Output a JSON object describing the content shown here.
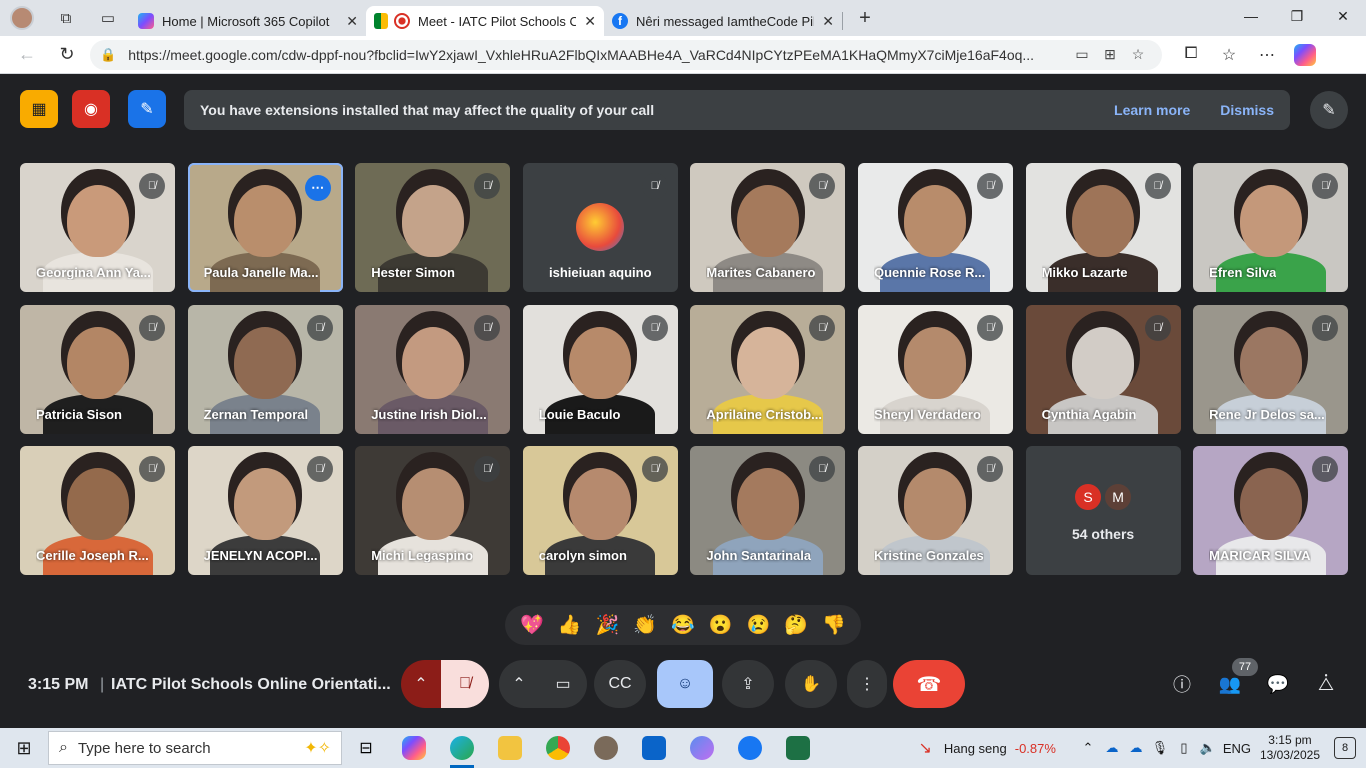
{
  "browser": {
    "tabs": [
      {
        "title": "Home | Microsoft 365 Copilot",
        "active": false
      },
      {
        "title": "Meet - IATC Pilot Schools On",
        "active": true
      },
      {
        "title": "Nêri messaged IamtheCode Pilot",
        "active": false
      }
    ],
    "url": "https://meet.google.com/cdw-dppf-nou?fbclid=IwY2xjawI_VxhleHRuA2FlbQIxMAABHe4A_VaRCd4NIpCYtzPEeMA1KHaQMmyX7ciMje16aF4oq..."
  },
  "banner": {
    "message": "You have extensions installed that may affect the quality of your call",
    "learn_more": "Learn more",
    "dismiss": "Dismiss"
  },
  "participants": [
    {
      "name": "Georgina Ann Ya...",
      "bg": "#d9d4cc",
      "skin": "#c99a7a",
      "shirt": "#e8e4de"
    },
    {
      "name": "Paula Janelle Ma...",
      "bg": "#b8a98a",
      "skin": "#b98e6c",
      "shirt": "#7d6a52",
      "speaking": true
    },
    {
      "name": "Hester Simon",
      "bg": "#6e6b55",
      "skin": "#c4a38a",
      "shirt": "#3d3a33"
    },
    {
      "name": "ishieiuan aquino",
      "bg": "#3c4043",
      "avatar": true
    },
    {
      "name": "Marites Cabanero",
      "bg": "#cfc9bf",
      "skin": "#a57a5c",
      "shirt": "#8e8a85"
    },
    {
      "name": "Quennie Rose R...",
      "bg": "#e9eaea",
      "skin": "#b88c6b",
      "shirt": "#5a76a8"
    },
    {
      "name": "Mikko Lazarte",
      "bg": "#e2e2e0",
      "skin": "#9e7458",
      "shirt": "#3a2e2a"
    },
    {
      "name": "Efren Silva",
      "bg": "#c9c7c2",
      "skin": "#c4987a",
      "shirt": "#3aa34a"
    },
    {
      "name": "Patricia Sison",
      "bg": "#bfb6a6",
      "skin": "#b38665",
      "shirt": "#1f1f1f"
    },
    {
      "name": "Zernan Temporal",
      "bg": "#b8b6a8",
      "skin": "#8f6a52",
      "shirt": "#7a828c"
    },
    {
      "name": "Justine Irish Diol...",
      "bg": "#8a7a72",
      "skin": "#c39a80",
      "shirt": "#6a5a66"
    },
    {
      "name": "Louie Baculo",
      "bg": "#e2e0dc",
      "skin": "#b78a6a",
      "shirt": "#1a1a1a"
    },
    {
      "name": "Aprilaine Cristob...",
      "bg": "#b8ad98",
      "skin": "#d6b49a",
      "shirt": "#e6c84a"
    },
    {
      "name": "Sheryl Verdadero",
      "bg": "#ebe9e4",
      "skin": "#b48a6c",
      "shirt": "#d8d4ce"
    },
    {
      "name": "Cynthia Agabin",
      "bg": "#6a4a3a",
      "skin": "#d2ccc6",
      "shirt": "#c8c6c4"
    },
    {
      "name": "Rene Jr Delos sa...",
      "bg": "#9a968c",
      "skin": "#9b7762",
      "shirt": "#c7cfd8"
    },
    {
      "name": "Cerille Joseph R...",
      "bg": "#d9cfb8",
      "skin": "#946a4c",
      "shirt": "#d8683a"
    },
    {
      "name": "JENELYN ACOPI...",
      "bg": "#ddd6c8",
      "skin": "#c29a7c",
      "shirt": "#3c3c3c"
    },
    {
      "name": "Michi Legaspino",
      "bg": "#3e3a36",
      "skin": "#b68e72",
      "shirt": "#e6e2dc"
    },
    {
      "name": "carolyn simon",
      "bg": "#d8c898",
      "skin": "#b68a6e",
      "shirt": "#3a3a3a"
    },
    {
      "name": "John Santarinala",
      "bg": "#8c8a82",
      "skin": "#a47a5e",
      "shirt": "#8fa4bc"
    },
    {
      "name": "Kristine Gonzales",
      "bg": "#d4d0c8",
      "skin": "#b48a6c",
      "shirt": "#c0c6cc"
    },
    {
      "others": true,
      "label": "54 others",
      "initials": [
        "S",
        "M"
      ],
      "colors": [
        "#d93025",
        "#5d4037"
      ]
    },
    {
      "name": "MARICAR SILVA",
      "bg": "#b6a6c4",
      "skin": "#8a6450",
      "shirt": "#e8e8ea"
    }
  ],
  "reactions": [
    "💖",
    "👍",
    "🎉",
    "👏",
    "😂",
    "😮",
    "😢",
    "🤔",
    "👎"
  ],
  "meeting": {
    "time": "3:15 PM",
    "separator": "|",
    "title": "IATC Pilot Schools Online Orientati...",
    "participant_count": "77"
  },
  "taskbar": {
    "search_placeholder": "Type here to search",
    "ticker_name": "Hang seng",
    "ticker_change": "-0.87%",
    "language": "ENG",
    "time": "3:15 pm",
    "date": "13/03/2025",
    "notifications": "8"
  },
  "colors": {
    "accent": "#8ab4f8",
    "end_call": "#ea4335",
    "mic_muted_bg": "#f9dedc",
    "reaction_active": "#a8c7fa"
  }
}
